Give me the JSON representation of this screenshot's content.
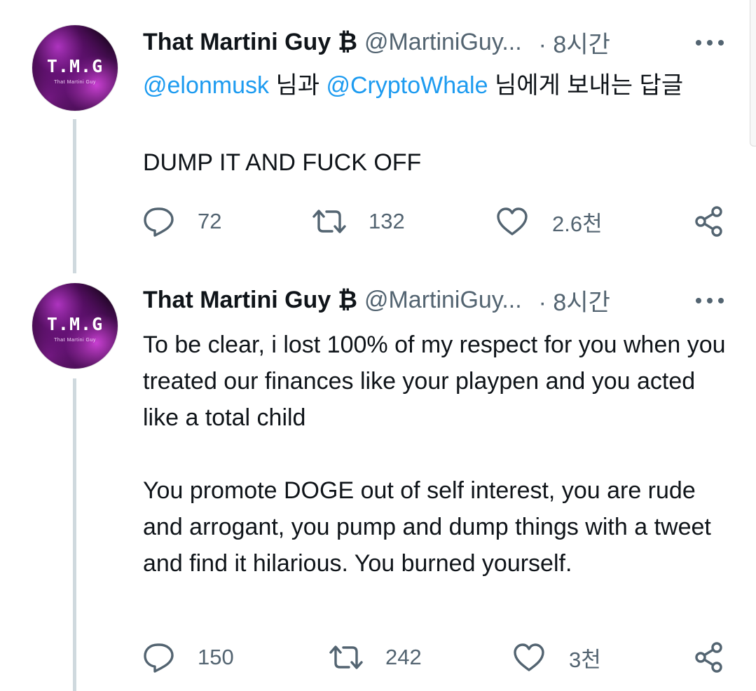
{
  "tweets": [
    {
      "author": {
        "name": "That Martini Guy",
        "badge": "₿",
        "handle": "@MartiniGuy...",
        "avatar_text": "T.M.G",
        "avatar_subtext": "That Martini Guy"
      },
      "time": "· 8시간",
      "reply_to": {
        "mention_1": "@elonmusk",
        "connector": " 님과 ",
        "mention_2": "@CryptoWhale",
        "suffix": " 님에게 보내는 답글"
      },
      "text": [
        "DUMP IT AND FUCK OFF"
      ],
      "stats": {
        "replies": "72",
        "retweets": "132",
        "likes": "2.6천"
      }
    },
    {
      "author": {
        "name": "That Martini Guy",
        "badge": "₿",
        "handle": "@MartiniGuy...",
        "avatar_text": "T.M.G",
        "avatar_subtext": "That Martini Guy"
      },
      "time": "· 8시간",
      "text": [
        "To be clear, i lost 100% of my respect for you when you treated our finances like your playpen and you acted like a total child",
        "You promote DOGE out of self interest, you are rude and arrogant, you pump and dump things with a tweet and find it hilarious. You burned yourself."
      ],
      "stats": {
        "replies": "150",
        "retweets": "242",
        "likes": "3천"
      }
    }
  ],
  "icons": {
    "reply": "reply-icon",
    "retweet": "retweet-icon",
    "like": "heart-icon",
    "share": "share-icon",
    "more": "more-dots-icon"
  },
  "colors": {
    "text": "#0f1419",
    "secondary": "#536471",
    "mention": "#1d9bf0",
    "thread_line": "#cfd9de"
  }
}
